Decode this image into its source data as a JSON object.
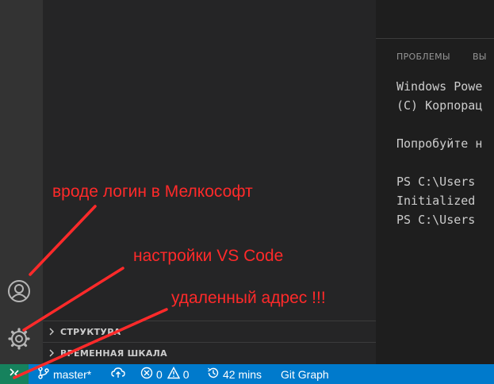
{
  "sidebar": {
    "sections": [
      {
        "label": "СТРУКТУРА"
      },
      {
        "label": "ВРЕМЕННАЯ ШКАЛА"
      }
    ]
  },
  "panel": {
    "tabs": [
      "ПРОБЛЕМЫ",
      "ВЫ"
    ],
    "terminal_lines": [
      "Windows Powe",
      "(C) Корпорац",
      "",
      "Попробуйте н",
      "",
      "PS C:\\Users",
      "Initialized",
      "PS C:\\Users"
    ]
  },
  "statusbar": {
    "branch": "master*",
    "errors": "0",
    "warnings": "0",
    "time": "42 mins",
    "git_graph": "Git Graph",
    "colors": {
      "bar": "#007acc",
      "remote": "#16825d"
    }
  },
  "annotations": {
    "account": "вроде логин в Мелкософт",
    "settings": "настройки VS Code",
    "remote": "удаленный адрес !!!",
    "color": "#ff2a2a"
  },
  "icons": {
    "account": "account-icon",
    "settings": "gear-icon",
    "remote": "remote-icon",
    "branch": "git-branch-icon",
    "sync": "cloud-sync-icon",
    "error": "error-icon",
    "warning": "warning-icon",
    "history": "history-icon"
  }
}
